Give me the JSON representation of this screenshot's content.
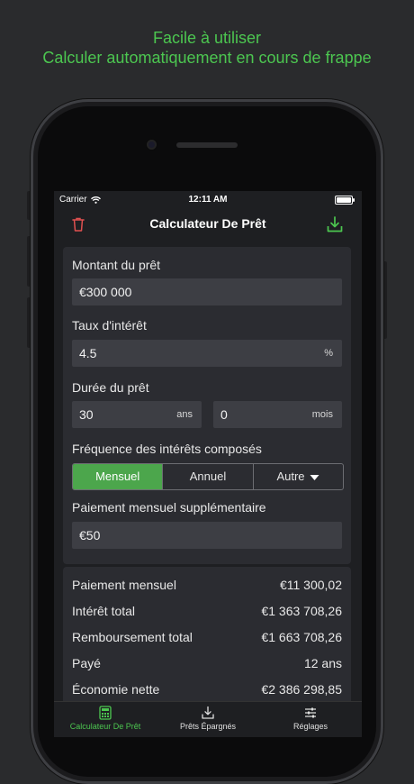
{
  "promo": {
    "line1": "Facile à utiliser",
    "line2": "Calculer automatiquement en cours de frappe"
  },
  "status_bar": {
    "carrier": "Carrier",
    "time": "12:11 AM"
  },
  "nav": {
    "title": "Calculateur De Prêt",
    "left_icon": "trash-icon",
    "right_icon": "download-icon"
  },
  "form": {
    "loan_amount": {
      "label": "Montant du prêt",
      "value": "€300 000"
    },
    "interest_rate": {
      "label": "Taux d'intérêt",
      "value": "4.5",
      "unit": "%"
    },
    "duration": {
      "label": "Durée du prêt",
      "years_value": "30",
      "years_unit": "ans",
      "months_value": "0",
      "months_unit": "mois"
    },
    "frequency": {
      "label": "Fréquence des intérêts composés",
      "options": [
        "Mensuel",
        "Annuel",
        "Autre"
      ],
      "selected": "Mensuel"
    },
    "extra_payment": {
      "label": "Paiement mensuel supplémentaire",
      "value": "€50"
    }
  },
  "results": [
    {
      "label": "Paiement mensuel",
      "value": "€11 300,02"
    },
    {
      "label": "Intérêt total",
      "value": "€1 363 708,26"
    },
    {
      "label": "Remboursement total",
      "value": "€1 663 708,26"
    },
    {
      "label": "Payé",
      "value": "12 ans"
    },
    {
      "label": "Économie nette",
      "value": "€2 386 298,85"
    }
  ],
  "tabs": [
    {
      "label": "Calculateur De Prêt",
      "icon": "calculator-icon",
      "active": true
    },
    {
      "label": "Prêts Épargnés",
      "icon": "download-icon",
      "active": false
    },
    {
      "label": "Réglages",
      "icon": "sliders-icon",
      "active": false
    }
  ],
  "colors": {
    "accent": "#4cc650",
    "segment_active": "#4ca64c",
    "delete": "#e05050"
  }
}
